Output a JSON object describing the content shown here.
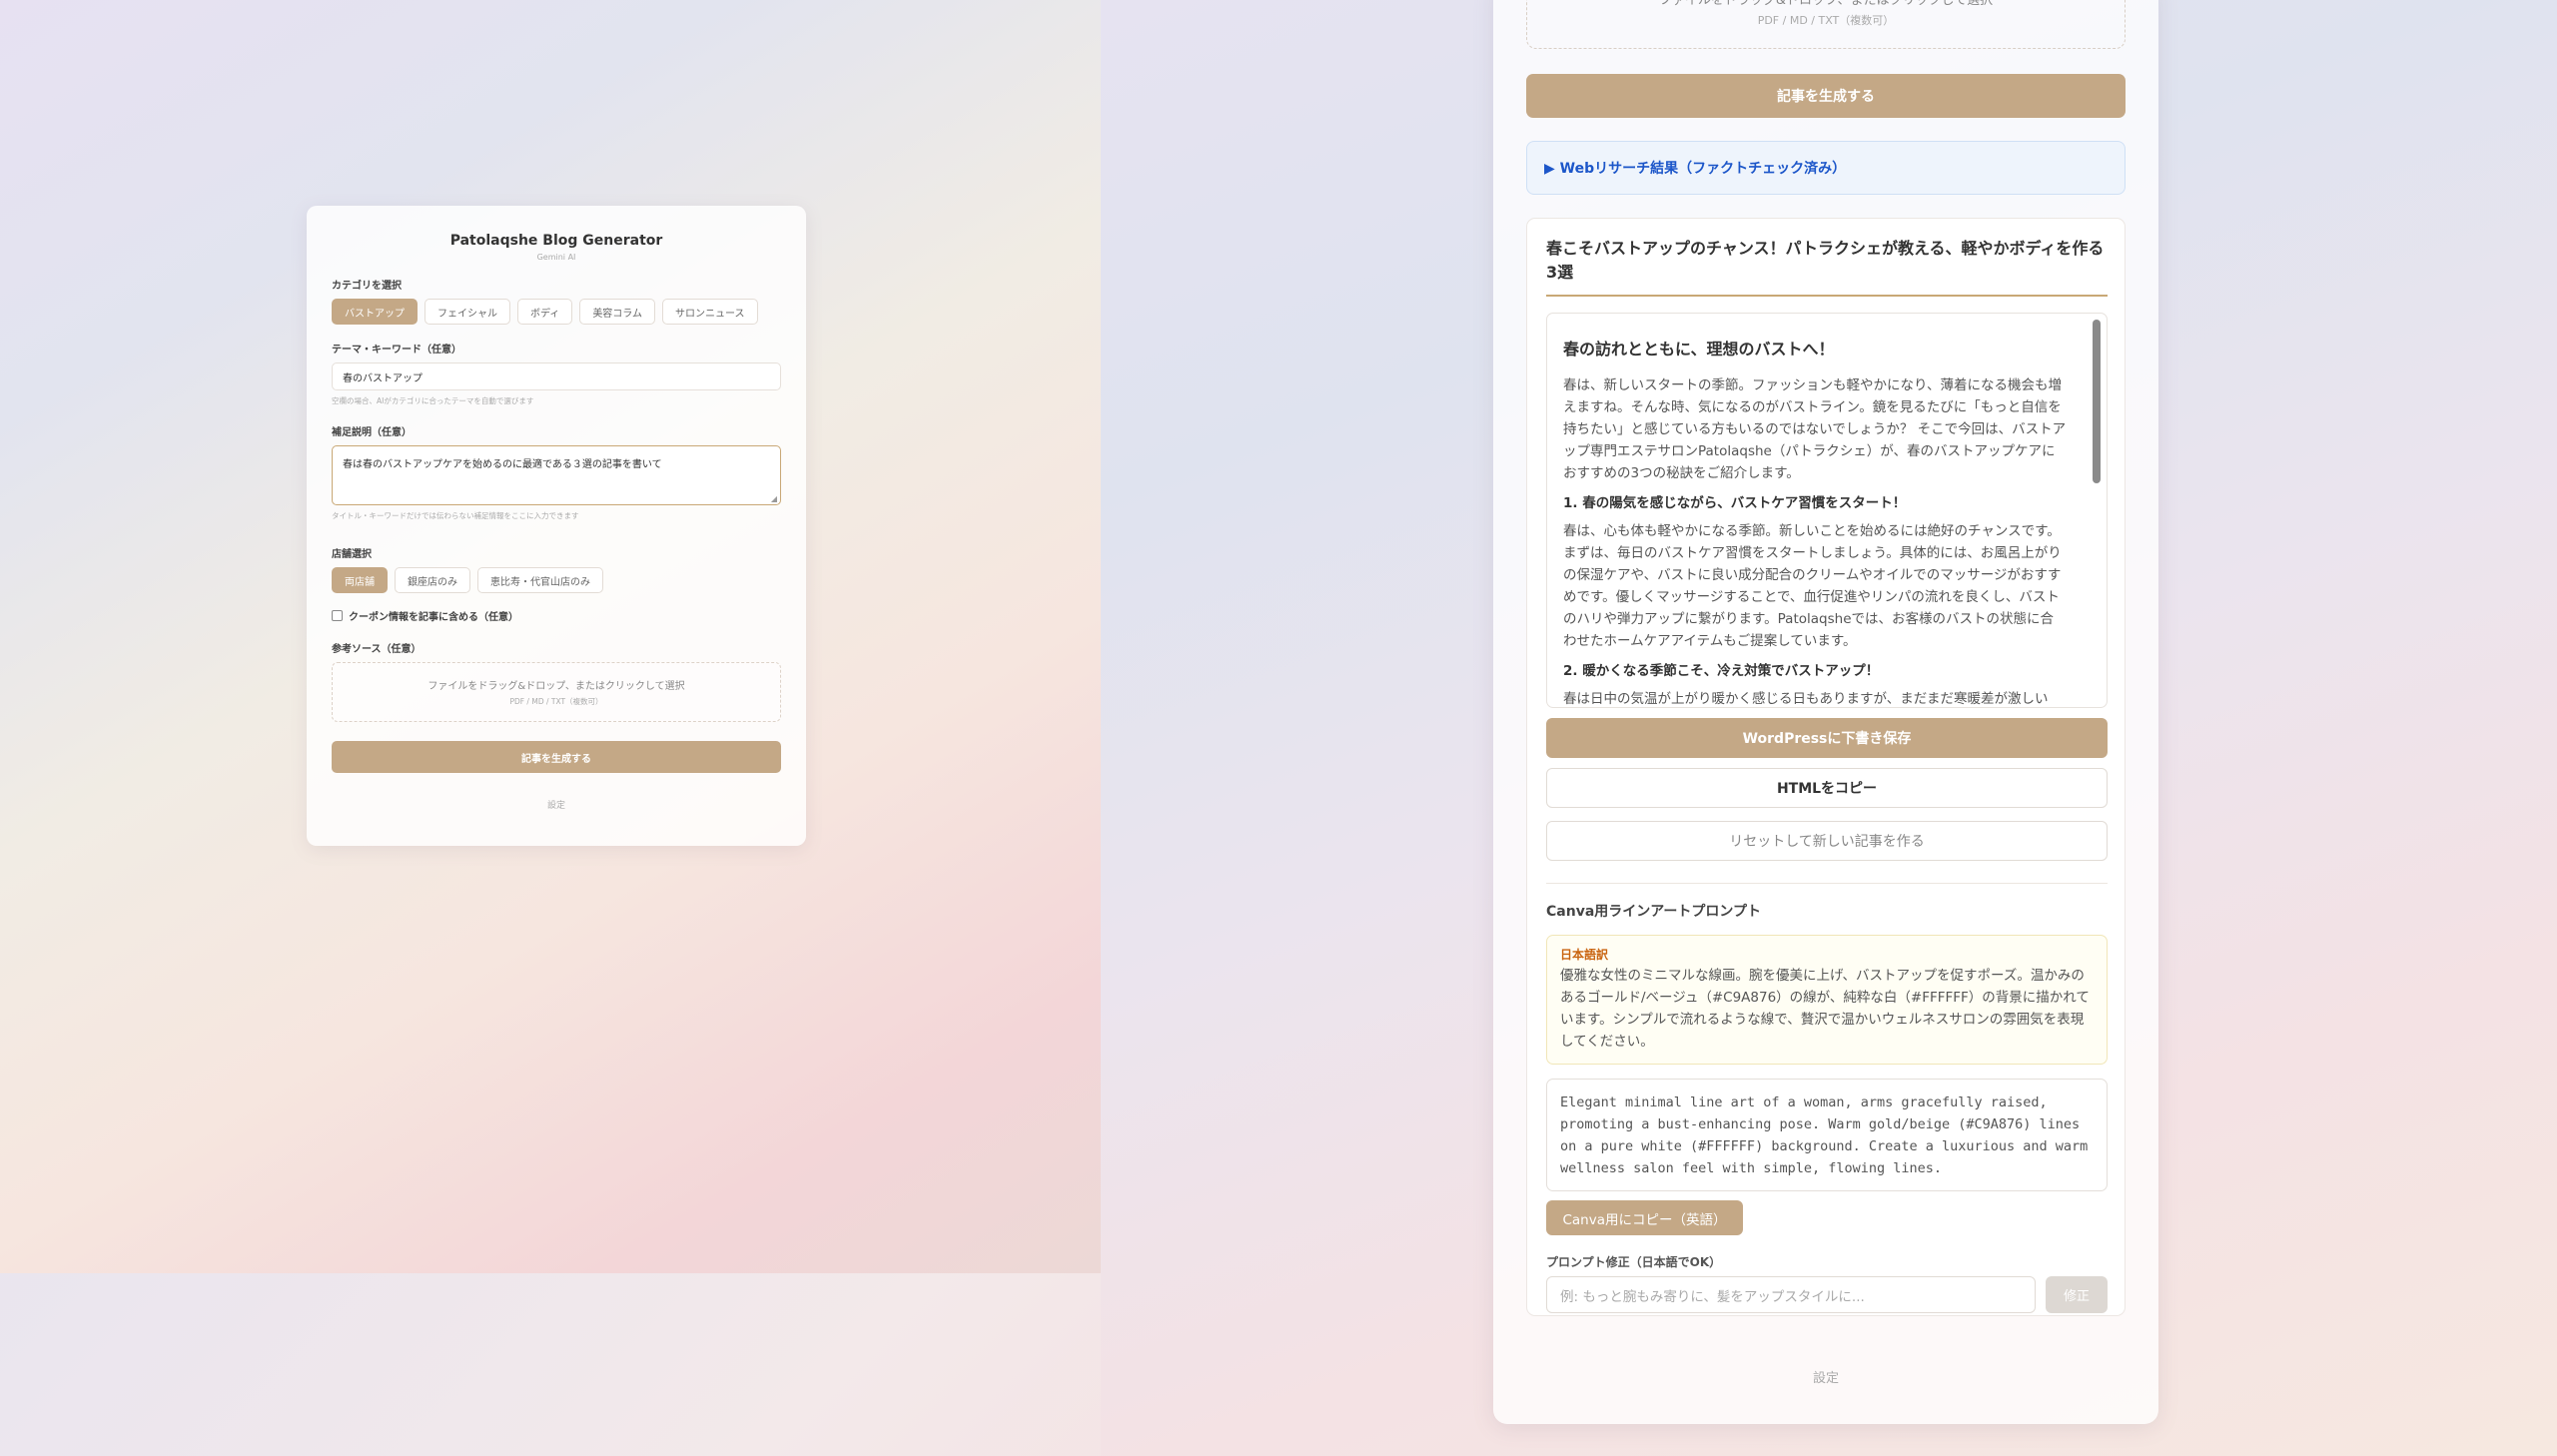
{
  "left": {
    "title": "Patolaqshe Blog Generator",
    "subtitle": "Gemini AI",
    "category_label": "カテゴリを選択",
    "categories": [
      "バストアップ",
      "フェイシャル",
      "ボディ",
      "美容コラム",
      "サロンニュース"
    ],
    "theme_label": "テーマ・キーワード（任意）",
    "theme_value": "春のバストアップ",
    "theme_hint": "空欄の場合、AIがカテゴリに合ったテーマを自動で選びます",
    "supplement_label": "補足説明（任意）",
    "supplement_value": "春は春のバストアップケアを始めるのに最適である３選の記事を書いて",
    "supplement_hint": "タイトル・キーワードだけでは伝わらない補足情報をここに入力できます",
    "store_label": "店舗選択",
    "stores": [
      "両店舗",
      "銀座店のみ",
      "恵比寿・代官山店のみ"
    ],
    "coupon_label": "クーポン情報を記事に含める（任意）",
    "source_label": "参考ソース（任意）",
    "drop_main": "ファイルをドラッグ&ドロップ、またはクリックして選択",
    "drop_sub": "PDF / MD / TXT（複数可）",
    "generate_label": "記事を生成する",
    "settings_label": "設定"
  },
  "right": {
    "drop_main": "ファイルをドラッグ&ドロップ、またはクリックして選択",
    "drop_sub": "PDF / MD / TXT（複数可）",
    "generate_label": "記事を生成する",
    "research_label": "▶ Webリサーチ結果（ファクトチェック済み）",
    "article_title": "春こそバストアップのチャンス！パトラクシェが教える、軽やかボディを作る3選",
    "body": {
      "h3": "春の訪れとともに、理想のバストへ！",
      "p1": "春は、新しいスタートの季節。ファッションも軽やかになり、薄着になる機会も増えますね。そんな時、気になるのがバストライン。鏡を見るたびに「もっと自信を持ちたい」と感じている方もいるのではないでしょうか？ そこで今回は、バストアップ専門エステサロンPatolaqshe（パトラクシェ）が、春のバストアップケアにおすすめの3つの秘訣をご紹介します。",
      "h4_1": "1. 春の陽気を感じながら、バストケア習慣をスタート！",
      "p2": "春は、心も体も軽やかになる季節。新しいことを始めるには絶好のチャンスです。まずは、毎日のバストケア習慣をスタートしましょう。具体的には、お風呂上がりの保湿ケアや、バストに良い成分配合のクリームやオイルでのマッサージがおすすめです。優しくマッサージすることで、血行促進やリンパの流れを良くし、バストのハリや弾力アップに繋がります。Patolaqsheでは、お客様のバストの状態に合わせたホームケアアイテムもご提案しています。",
      "h4_2": "2. 暖かくなる季節こそ、冷え対策でバストアップ！",
      "p3": "春は日中の気温が上がり暖かく感じる日もありますが、まだまだ寒暖差が激しい"
    },
    "wp_label": "WordPressに下書き保存",
    "html_label": "HTMLをコピー",
    "reset_label": "リセットして新しい記事を作る",
    "canva_title": "Canva用ラインアートプロンプト",
    "jp_label": "日本語訳",
    "jp_text": "優雅な女性のミニマルな線画。腕を優美に上げ、バストアップを促すポーズ。温かみのあるゴールド/ベージュ（#C9A876）の線が、純粋な白（#FFFFFF）の背景に描かれています。シンプルで流れるような線で、贅沢で温かいウェルネスサロンの雰囲気を表現してください。",
    "en_text": "Elegant minimal line art of a woman, arms gracefully raised, promoting a bust-enhancing pose. Warm gold/beige (#C9A876) lines on a pure white (#FFFFFF) background. Create a luxurious and warm wellness salon feel with simple, flowing lines.",
    "canva_copy_label": "Canva用にコピー（英語）",
    "fix_label": "プロンプト修正（日本語でOK）",
    "fix_placeholder": "例: もっと腕もみ寄りに、髪をアップスタイルに...",
    "fix_button": "修正",
    "settings_label": "設定"
  },
  "colors": {
    "accent": "#C4A886",
    "link": "#1C56C9",
    "jp_label": "#C96410"
  }
}
